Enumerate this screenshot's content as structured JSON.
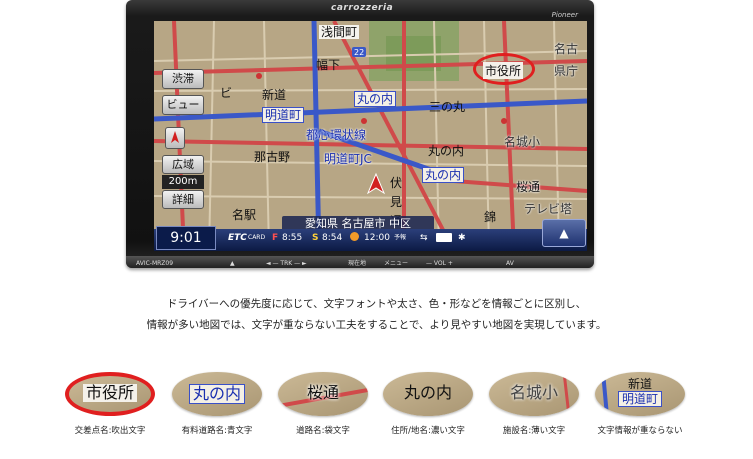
{
  "device": {
    "brand": "carrozzeria",
    "maker": "Pioneer",
    "model": "AVIC-MRZ09",
    "bottom_buttons": [
      "▲",
      "◄ — TRK — ►",
      "現在地",
      "メニュー",
      "— VOL +",
      "AV"
    ]
  },
  "map": {
    "place_labels": [
      "浅間町",
      "幅下",
      "新道",
      "三の丸",
      "那古野",
      "名城小",
      "伏",
      "見",
      "通",
      "名駅",
      "名古",
      "県庁",
      "ビ",
      "桜通",
      "テレビ塔",
      "錦"
    ],
    "road_labels": [
      "都心環状線",
      "明道町JC"
    ],
    "blue_labels": [
      "明道町",
      "丸の内",
      "丸の内"
    ],
    "white_labels": [
      "三の丸",
      "丸の内"
    ],
    "callout_label": "市役所",
    "route_number": "22",
    "address": "愛知県 名古屋市 中区"
  },
  "sidebar": {
    "traffic_line1": "渋滞",
    "traffic_line2": "ビュー",
    "wide_label": "広域",
    "scale_label": "200m",
    "detail_label": "詳細"
  },
  "status": {
    "time": "9:01",
    "etc_label": "ETC",
    "etc_sub": "CARD",
    "f_label": "F",
    "f_time": "8:55",
    "s_label": "S",
    "s_time": "8:54",
    "arrival_time": "12:00",
    "arrival_label": "予報"
  },
  "caption": {
    "line1": "ドライバーへの優先度に応じて、文字フォントや太さ、色・形などを情報ごとに区別し、",
    "line2": "情報が多い地図では、文字が重ならない工夫をすることで、より見やすい地図を実現しています。"
  },
  "samples": [
    {
      "text": "市役所",
      "label": "交差点名:吹出文字"
    },
    {
      "text": "丸の内",
      "label": "有料道路名:青文字"
    },
    {
      "text": "桜通",
      "label": "道路名:袋文字"
    },
    {
      "text": "丸の内",
      "label": "住所/地名:濃い文字"
    },
    {
      "text": "名城小",
      "label": "施設名:薄い文字"
    },
    {
      "text_line1": "新道",
      "text_line2": "明道町",
      "label": "文字情報が重ならない"
    }
  ]
}
